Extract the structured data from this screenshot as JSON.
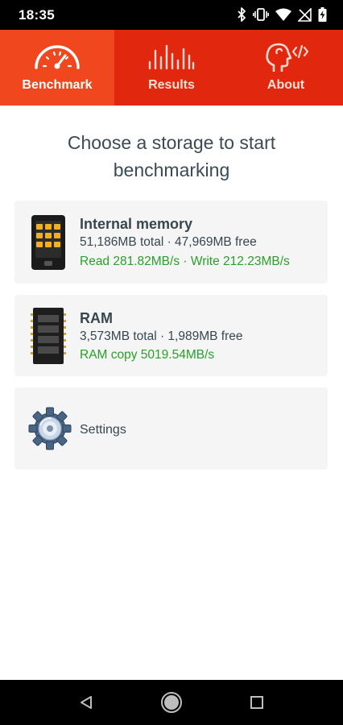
{
  "status_bar": {
    "time": "18:35",
    "icons": [
      "bluetooth-icon",
      "vibrate-icon",
      "wifi-icon",
      "no-signal-icon",
      "battery-charging-icon"
    ]
  },
  "tabs": [
    {
      "label": "Benchmark",
      "icon": "speedometer-icon",
      "active": true
    },
    {
      "label": "Results",
      "icon": "bars-chart-icon",
      "active": false
    },
    {
      "label": "About",
      "icon": "head-code-icon",
      "active": false
    }
  ],
  "main": {
    "title": "Choose a storage to start benchmarking",
    "storages": [
      {
        "name": "Internal memory",
        "info": "51,186MB total · 47,969MB free",
        "speed": "Read 281.82MB/s · Write 212.23MB/s",
        "icon": "phone-storage-icon"
      },
      {
        "name": "RAM",
        "info": "3,573MB total · 1,989MB free",
        "speed": "RAM copy 5019.54MB/s",
        "icon": "ram-chip-icon"
      }
    ],
    "settings": {
      "label": "Settings",
      "icon": "gear-icon"
    }
  },
  "colors": {
    "tab_bar": "#e2270f",
    "tab_active": "#f0471f",
    "speed_text": "#27a127",
    "card_bg": "#f5f5f5",
    "text": "#37474f",
    "title_text": "#3b4a55"
  },
  "nav_bar": {
    "buttons": [
      "back-icon",
      "home-icon",
      "recents-icon"
    ]
  }
}
